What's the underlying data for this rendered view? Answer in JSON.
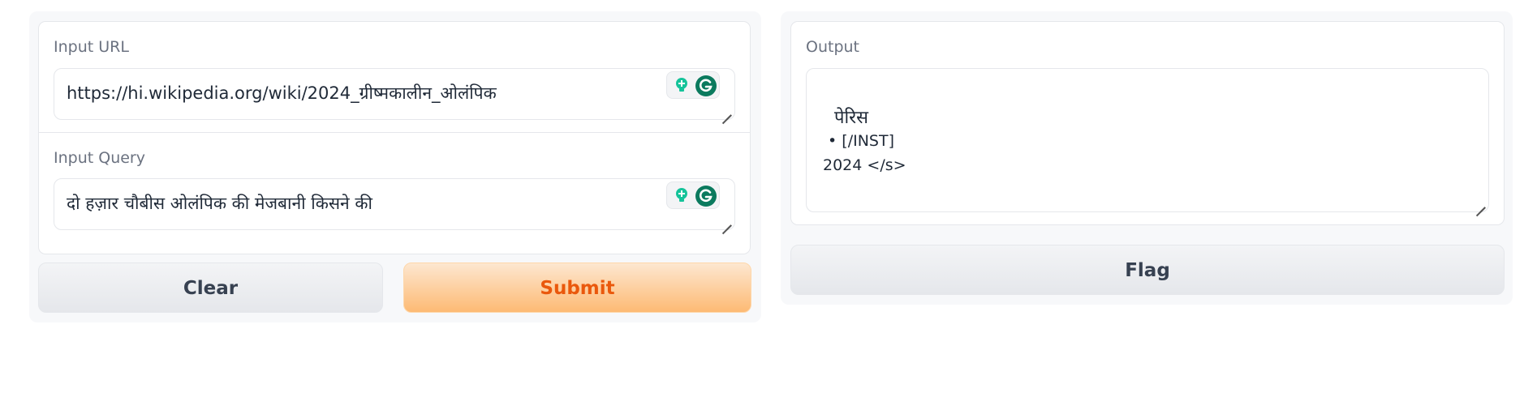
{
  "inputs": {
    "url": {
      "label": "Input URL",
      "value": "https://hi.wikipedia.org/wiki/2024_ग्रीष्मकालीन_ओलंपिक"
    },
    "query": {
      "label": "Input Query",
      "value": "दो हज़ार चौबीस ओलंपिक की मेजबानी किसने की"
    }
  },
  "buttons": {
    "clear": "Clear",
    "submit": "Submit",
    "flag": "Flag"
  },
  "output": {
    "label": "Output",
    "lines": [
      "  पेरिस",
      " • [/INST]",
      "2024 </s>"
    ]
  },
  "colors": {
    "submit_text": "#ea580c",
    "submit_bg": "#fdba74",
    "grammarly_green": "#15c39a",
    "grammarly_dark": "#0b7a5e"
  },
  "icons": {
    "bulb": "lightbulb-icon",
    "grammarly": "grammarly-icon",
    "resize": "resize-handle-icon"
  }
}
